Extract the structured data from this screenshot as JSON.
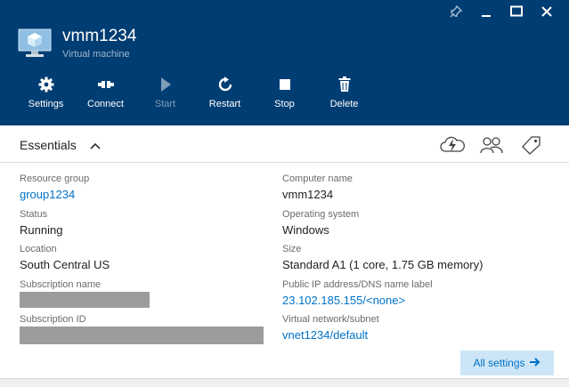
{
  "blade": {
    "title": "vmm1234",
    "subtitle": "Virtual machine"
  },
  "window_controls": [
    "pin-icon",
    "minimize-icon",
    "maximize-icon",
    "close-icon"
  ],
  "toolbar": {
    "settings": "Settings",
    "connect": "Connect",
    "start": "Start",
    "restart": "Restart",
    "stop": "Stop",
    "delete": "Delete"
  },
  "essentials": {
    "label": "Essentials",
    "icons": [
      "cloud-lightning-icon",
      "users-icon",
      "tag-icon"
    ],
    "left": {
      "resource_group": {
        "label": "Resource group",
        "value": "group1234"
      },
      "status": {
        "label": "Status",
        "value": "Running"
      },
      "location": {
        "label": "Location",
        "value": "South Central US"
      },
      "subscription_name": {
        "label": "Subscription name"
      },
      "subscription_id": {
        "label": "Subscription ID"
      }
    },
    "right": {
      "computer_name": {
        "label": "Computer name",
        "value": "vmm1234"
      },
      "os": {
        "label": "Operating system",
        "value": "Windows"
      },
      "size": {
        "label": "Size",
        "value": "Standard A1 (1 core, 1.75 GB memory)"
      },
      "public_ip": {
        "label": "Public IP address/DNS name label",
        "value": "23.102.185.155/<none>"
      },
      "vnet": {
        "label": "Virtual network/subnet",
        "value": "vnet1234/default"
      }
    },
    "all_settings": "All settings"
  },
  "colors": {
    "header_bg": "#003d73",
    "link": "#0072c6",
    "button_bg": "#cde6f7"
  }
}
